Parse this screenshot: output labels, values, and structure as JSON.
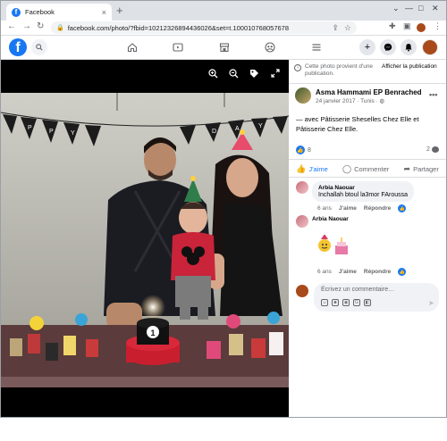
{
  "browser": {
    "tab_title": "Facebook",
    "tab_close": "×",
    "new_tab": "+",
    "url": "facebook.com/photo/?fbid=10212326894436026&set=t.100010768057678",
    "window_controls": [
      "—",
      "□",
      "✕"
    ]
  },
  "fb_nav": {
    "logo": "f",
    "search_icon": "search-icon",
    "center_icons": [
      "home-icon",
      "watch-icon",
      "marketplace-icon",
      "groups-icon",
      "menu-icon"
    ],
    "right_icons": [
      "plus-icon",
      "messenger-icon",
      "bell-icon"
    ]
  },
  "photo": {
    "tools": [
      "zoom-in-icon",
      "zoom-out-icon",
      "tag-icon",
      "fullscreen-icon"
    ],
    "banner_text": "HAPPY BIRTHDAY",
    "cake_number": "1"
  },
  "sidebar": {
    "notice_text": "Cette photo provient d'une publication.",
    "notice_link": "Afficher la publication",
    "author_name": "Asma Hammami EP Benrached",
    "author_meta": "24 janvier 2017 · Tunis · ",
    "more": "•••",
    "caption": "— avec Pâtisserie Sheselles Chez Elle et Pâtisserie Chez Elle.",
    "reaction_count": "8",
    "comment_count": "2",
    "actions": {
      "like": "J'aime",
      "comment": "Commenter",
      "share": "Partager"
    },
    "comments": [
      {
        "name": "Arbia Naouar",
        "text": "Inchallah btoul la3mor FAroussa",
        "time": "6 ans",
        "like": "J'aime",
        "reply": "Répondre"
      },
      {
        "name": "Arbia Naouar",
        "text": "",
        "time": "6 ans",
        "like": "J'aime",
        "reply": "Répondre"
      }
    ],
    "write_placeholder": "Écrivez un commentaire…",
    "colors": {
      "accent": "#1877f2",
      "muted": "#65676b"
    }
  }
}
